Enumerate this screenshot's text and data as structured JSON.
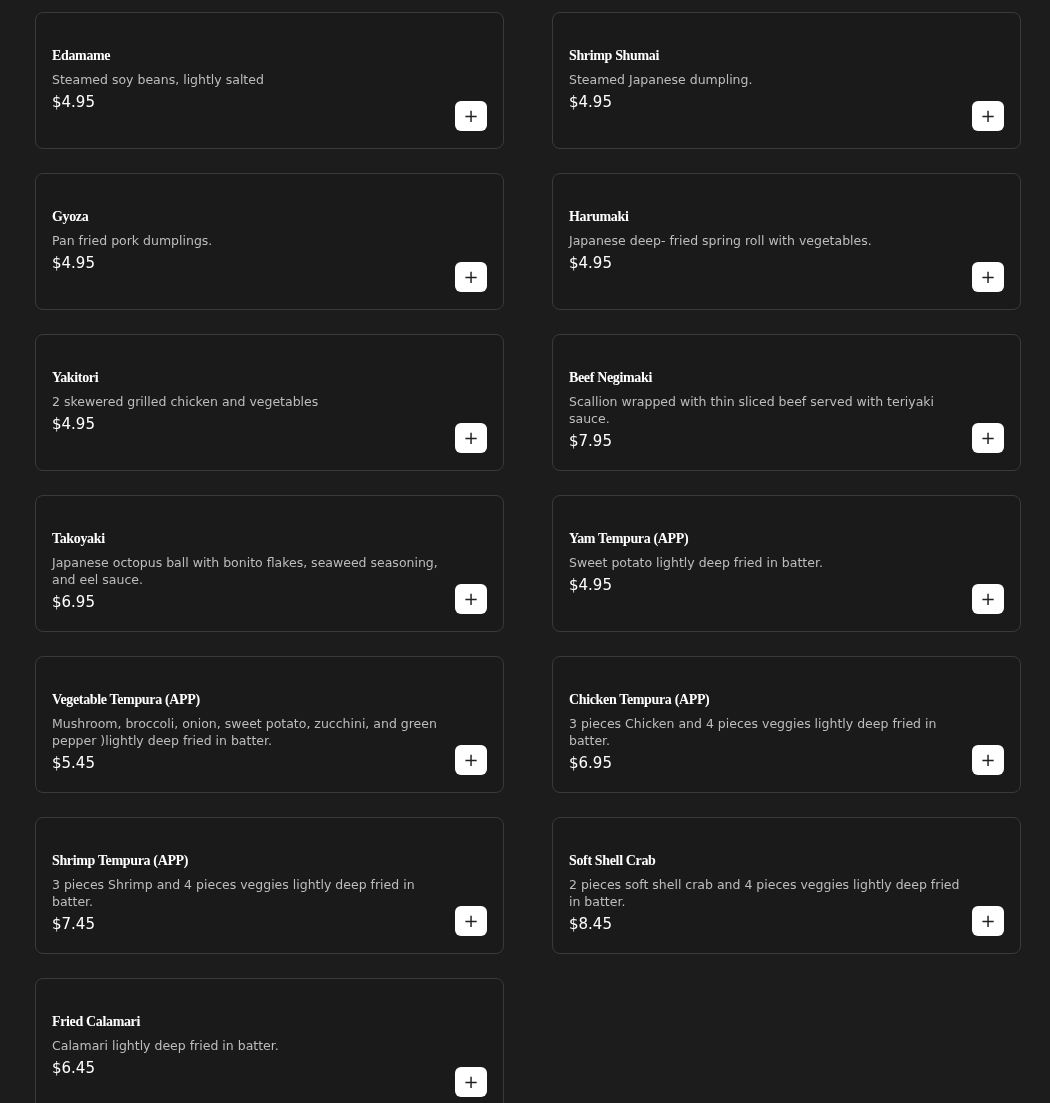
{
  "menu_items": [
    {
      "name": "Edamame",
      "description": "Steamed soy beans, lightly salted",
      "price": "$4.95",
      "add_button": "+"
    },
    {
      "name": "Shrimp Shumai",
      "description": "Steamed Japanese dumpling.",
      "price": "$4.95",
      "add_button": "+"
    },
    {
      "name": "Gyoza",
      "description": "Pan fried pork dumplings.",
      "price": "$4.95",
      "add_button": "+"
    },
    {
      "name": "Harumaki",
      "description": "Japanese deep- fried spring roll with vegetables.",
      "price": "$4.95",
      "add_button": "+"
    },
    {
      "name": "Yakitori",
      "description": "2 skewered grilled chicken and vegetables",
      "price": "$4.95",
      "add_button": "+"
    },
    {
      "name": "Beef Negimaki",
      "description": "Scallion wrapped with thin sliced beef served with teriyaki sauce.",
      "price": "$7.95",
      "add_button": "+"
    },
    {
      "name": "Takoyaki",
      "description": "Japanese octopus ball with bonito flakes, seaweed seasoning, and eel sauce.",
      "price": "$6.95",
      "add_button": "+"
    },
    {
      "name": "Yam Tempura (APP)",
      "description": "Sweet potato lightly deep fried in batter.",
      "price": "$4.95",
      "add_button": "+"
    },
    {
      "name": "Vegetable Tempura (APP)",
      "description": "Mushroom, broccoli, onion, sweet potato, zucchini, and green pepper )lightly deep fried in batter.",
      "price": "$5.45",
      "add_button": "+"
    },
    {
      "name": "Chicken Tempura (APP)",
      "description": "3 pieces Chicken and 4 pieces veggies lightly deep fried in batter.",
      "price": "$6.95",
      "add_button": "+"
    },
    {
      "name": "Shrimp Tempura (APP)",
      "description": "3 pieces Shrimp and 4 pieces veggies lightly deep fried in batter.",
      "price": "$7.45",
      "add_button": "+"
    },
    {
      "name": "Soft Shell Crab",
      "description": "2 pieces soft shell crab and 4 pieces veggies lightly deep fried in batter.",
      "price": "$8.45",
      "add_button": "+"
    },
    {
      "name": "Fried Calamari",
      "description": "Calamari lightly deep fried in batter.",
      "price": "$6.45",
      "add_button": "+"
    }
  ]
}
